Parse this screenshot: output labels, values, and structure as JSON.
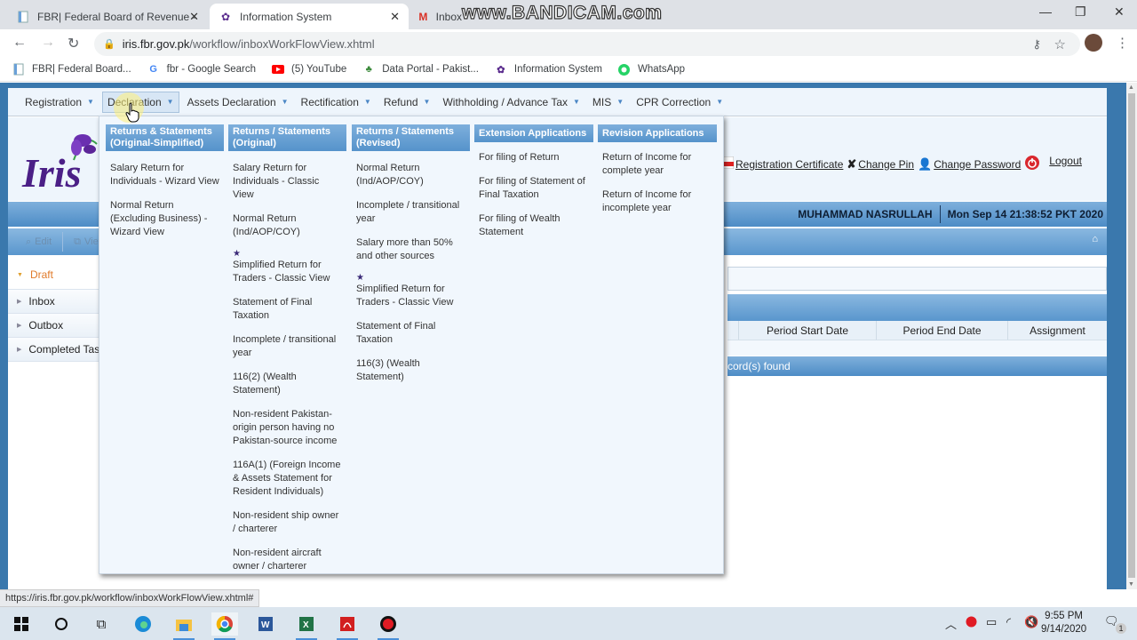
{
  "browser": {
    "tabs": [
      {
        "title": "FBR| Federal Board of Revenue -",
        "icon": "doc-icon",
        "active": false
      },
      {
        "title": "Information System",
        "icon": "iris-icon",
        "active": true
      },
      {
        "title": "Inbox",
        "icon": "gmail-icon",
        "active": false
      }
    ],
    "watermark": "www.BANDICAM.com",
    "url_host": "iris.fbr.gov.pk",
    "url_path": "/workflow/inboxWorkFlowView.xhtml",
    "bookmarks": [
      {
        "label": "FBR| Federal Board...",
        "icon": "doc-icon"
      },
      {
        "label": "fbr - Google Search",
        "icon": "google-icon"
      },
      {
        "label": "(5) YouTube",
        "icon": "youtube-icon"
      },
      {
        "label": "Data Portal - Pakist...",
        "icon": "data-portal-icon"
      },
      {
        "label": "Information System",
        "icon": "iris-icon"
      },
      {
        "label": "WhatsApp",
        "icon": "whatsapp-icon"
      }
    ],
    "status_url": "https://iris.fbr.gov.pk/workflow/inboxWorkFlowView.xhtml#"
  },
  "menu": [
    {
      "label": "Registration"
    },
    {
      "label": "Declaration",
      "hover": true
    },
    {
      "label": "Assets Declaration"
    },
    {
      "label": "Rectification"
    },
    {
      "label": "Refund"
    },
    {
      "label": "Withholding / Advance Tax"
    },
    {
      "label": "MIS"
    },
    {
      "label": "CPR Correction"
    }
  ],
  "header_links": [
    {
      "label": "Registration Certificate",
      "icon": "pdf-icon"
    },
    {
      "label": "Change Pin",
      "icon": "tools-icon"
    },
    {
      "label": "Change Password",
      "icon": "user-key-icon"
    },
    {
      "label": "Logout",
      "icon": "power-icon"
    }
  ],
  "user": {
    "name": "MUHAMMAD NASRULLAH",
    "datetime": "Mon Sep 14 21:38:52 PKT 2020"
  },
  "toolbar": {
    "edit": "Edit",
    "view": "View"
  },
  "sidebar": [
    {
      "label": "Draft",
      "expanded": true
    },
    {
      "label": "Inbox"
    },
    {
      "label": "Outbox"
    },
    {
      "label": "Completed Task"
    }
  ],
  "grid": {
    "columns": [
      "Period Start Date",
      "Period End Date",
      "Assignment"
    ],
    "footer": "cord(s) found"
  },
  "dropdown": {
    "columns": [
      {
        "heading": "Returns & Statements (Original-Simplified)",
        "items": [
          {
            "label": "Salary Return for Individuals - Wizard View"
          },
          {
            "label": "Normal Return (Excluding Business) - Wizard View"
          }
        ]
      },
      {
        "heading": "Returns / Statements (Original)",
        "items": [
          {
            "label": "Salary Return for Individuals - Classic View"
          },
          {
            "label": "Normal Return (Ind/AOP/COY)"
          },
          {
            "label": "Simplified Return for Traders - Classic View",
            "star": true
          },
          {
            "label": "Statement of Final Taxation"
          },
          {
            "label": "Incomplete / transitional year"
          },
          {
            "label": "116(2) (Wealth Statement)"
          },
          {
            "label": "Non-resident Pakistan-origin person having no Pakistan-source income"
          },
          {
            "label": "116A(1) (Foreign Income & Assets Statement for Resident Individuals)"
          },
          {
            "label": "Non-resident ship owner / charterer"
          },
          {
            "label": "Non-resident aircraft owner / charterer"
          }
        ]
      },
      {
        "heading": "Returns / Statements (Revised)",
        "items": [
          {
            "label": "Normal Return (Ind/AOP/COY)"
          },
          {
            "label": "Incomplete / transitional year"
          },
          {
            "label": "Salary more than 50% and other sources"
          },
          {
            "label": "Simplified Return for Traders - Classic View",
            "star": true
          },
          {
            "label": "Statement of Final Taxation"
          },
          {
            "label": "116(3) (Wealth Statement)"
          }
        ]
      },
      {
        "heading": "Extension Applications",
        "items": [
          {
            "label": "For filing of Return"
          },
          {
            "label": "For filing of Statement of Final Taxation"
          },
          {
            "label": "For filing of Wealth Statement"
          }
        ]
      },
      {
        "heading": "Revision Applications",
        "items": [
          {
            "label": "Return of Income for complete year"
          },
          {
            "label": "Return of Income for incomplete year"
          }
        ]
      }
    ]
  },
  "taskbar": {
    "time": "9:55 PM",
    "date": "9/14/2020",
    "notification_count": "1"
  }
}
